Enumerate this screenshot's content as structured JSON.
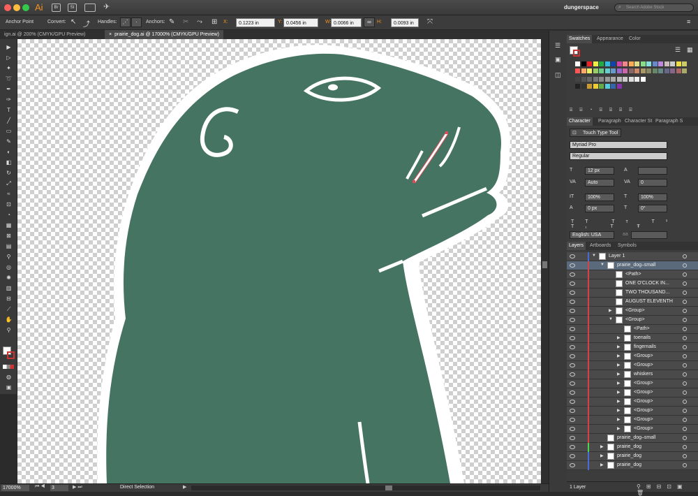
{
  "app": {
    "logo": "Ai",
    "bridge": "Br",
    "stock": "St",
    "workspace": "dungerspace",
    "search_placeholder": "Search Adobe Stock"
  },
  "control": {
    "tool": "Anchor Point",
    "convert_label": "Convert:",
    "handles_label": "Handles:",
    "anchors_label": "Anchors:",
    "x_label": "X:",
    "x_value": "0.1223 in",
    "y_label": "Y:",
    "y_value": "0.0456 in",
    "w_label": "W:",
    "w_value": "0.0066 in",
    "h_label": "H:",
    "h_value": "0.0093 in"
  },
  "tabs": [
    {
      "label": "ign.ai @ 200% (CMYK/GPU Preview)"
    },
    {
      "label": "prairie_dog.ai @ 17000% (CMYK/GPU Preview)"
    }
  ],
  "status": {
    "zoom": "17000%",
    "page": "3",
    "mode": "Direct Selection"
  },
  "panels": {
    "swatch_tabs": [
      "Swatches",
      "Appearance",
      "Color"
    ],
    "char_tabs": [
      "Character",
      "Paragraph",
      "Character St",
      "Paragraph S"
    ],
    "touch_type": "Touch Type Tool",
    "font": "Myriad Pro",
    "style": "Regular",
    "size": "12 px",
    "leading": "",
    "kerning": "Auto",
    "tracking": "0",
    "vscale": "100%",
    "hscale": "100%",
    "baseline": "0 px",
    "rotation": "0°",
    "language": "English: USA",
    "aa": "",
    "layer_tabs": [
      "Layers",
      "Artboards",
      "Symbols"
    ],
    "layer_count": "1 Layer"
  },
  "layers": [
    {
      "name": "Layer 1"
    },
    {
      "name": "prairie_dog–small"
    },
    {
      "name": "<Path>"
    },
    {
      "name": "ONE O'CLOCK IN..."
    },
    {
      "name": "TWO THOUSAND..."
    },
    {
      "name": "AUGUST ELEVENTH"
    },
    {
      "name": "<Group>"
    },
    {
      "name": "<Group>"
    },
    {
      "name": "<Path>"
    },
    {
      "name": "toenails"
    },
    {
      "name": "fingernails"
    },
    {
      "name": "<Group>"
    },
    {
      "name": "<Group>"
    },
    {
      "name": "whiskers"
    },
    {
      "name": "<Group>"
    },
    {
      "name": "<Group>"
    },
    {
      "name": "<Group>"
    },
    {
      "name": "<Group>"
    },
    {
      "name": "<Group>"
    },
    {
      "name": "<Group>"
    },
    {
      "name": "prairie_dog–small"
    },
    {
      "name": "prairie_dog"
    },
    {
      "name": "prairie_dog"
    },
    {
      "name": "prairie_dog"
    }
  ],
  "colors": {
    "body": "#467463",
    "outline": "#ffffff",
    "selection": "#d4505a"
  }
}
